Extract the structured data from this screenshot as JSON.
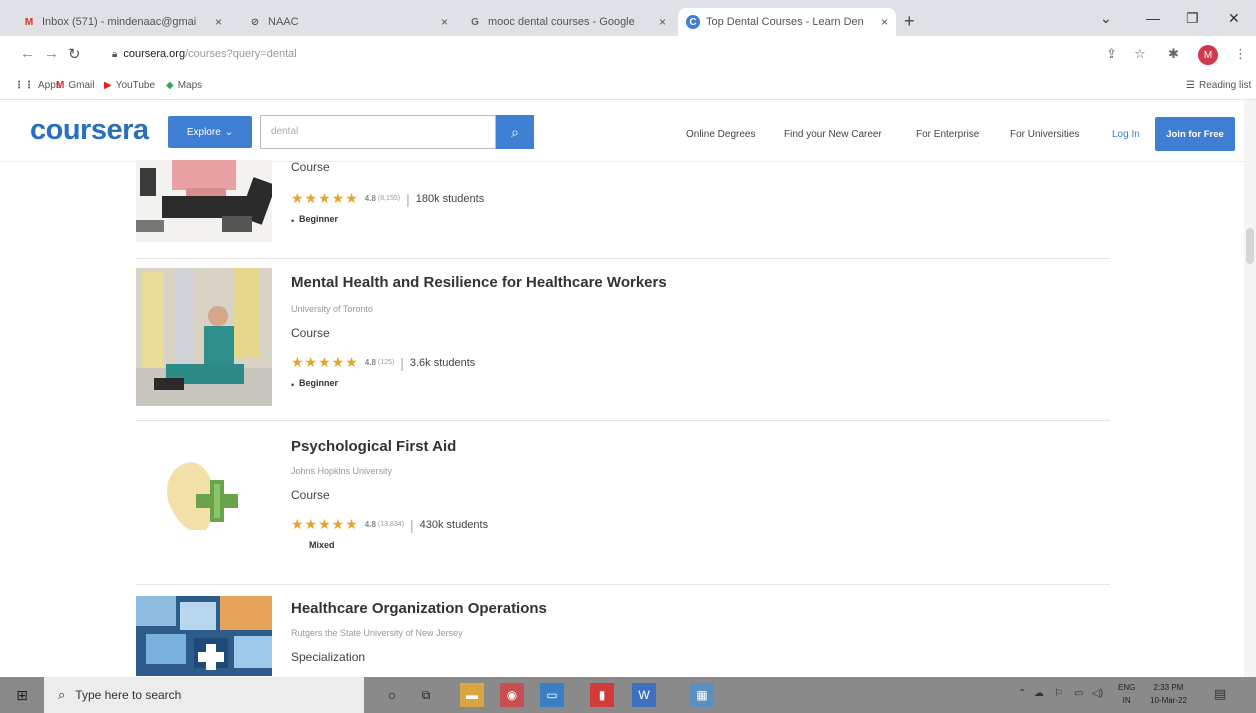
{
  "browser": {
    "tabs": [
      {
        "icon": "gmail-icon",
        "title": "Inbox (571) - mindenaac@gmai"
      },
      {
        "icon": "globe-icon",
        "title": "NAAC"
      },
      {
        "icon": "google-icon",
        "title": "mooc dental courses - Google"
      },
      {
        "icon": "coursera-icon",
        "title": "Top Dental Courses - Learn Den"
      }
    ],
    "new_tab": "+",
    "url_domain": "coursera.org",
    "url_path": "/courses?query=dental",
    "bookmarks": [
      {
        "label": "Apps"
      },
      {
        "label": "Gmail"
      },
      {
        "label": "YouTube"
      },
      {
        "label": "Maps"
      }
    ],
    "reading_list": "Reading list"
  },
  "coursera": {
    "logo": "coursera",
    "explore_label": "Explore",
    "search_value": "dental",
    "nav": [
      {
        "label": "Online Degrees"
      },
      {
        "label": "Find your New Career"
      },
      {
        "label": "For Enterprise"
      },
      {
        "label": "For Universities"
      }
    ],
    "login_label": "Log In",
    "join_label": "Join for Free"
  },
  "courses": [
    {
      "title": "",
      "partner": "",
      "type": "Course",
      "rating": "4.8",
      "rating_count": "(8,155)",
      "students": "180k students",
      "level": "Beginner"
    },
    {
      "title": "Mental Health and Resilience for Healthcare Workers",
      "partner": "University of Toronto",
      "type": "Course",
      "rating": "4.8",
      "rating_count": "(125)",
      "students": "3.6k students",
      "level": "Beginner"
    },
    {
      "title": "Psychological First Aid",
      "partner": "Johns Hopkins University",
      "type": "Course",
      "rating": "4.8",
      "rating_count": "(13,834)",
      "students": "430k students",
      "level": "Mixed"
    },
    {
      "title": "Healthcare Organization Operations",
      "partner": "Rutgers the State University of New Jersey",
      "type": "Specialization",
      "rating": "",
      "rating_count": "",
      "students": "",
      "level": ""
    }
  ],
  "taskbar": {
    "search_placeholder": "Type here to search",
    "lang_top": "ENG",
    "lang_bottom": "IN",
    "time": "2:33 PM",
    "date": "10-Mar-22"
  },
  "colors": {
    "brand": "#2b6fbf",
    "button": "#3e7ed3",
    "star": "#e8a32f"
  }
}
